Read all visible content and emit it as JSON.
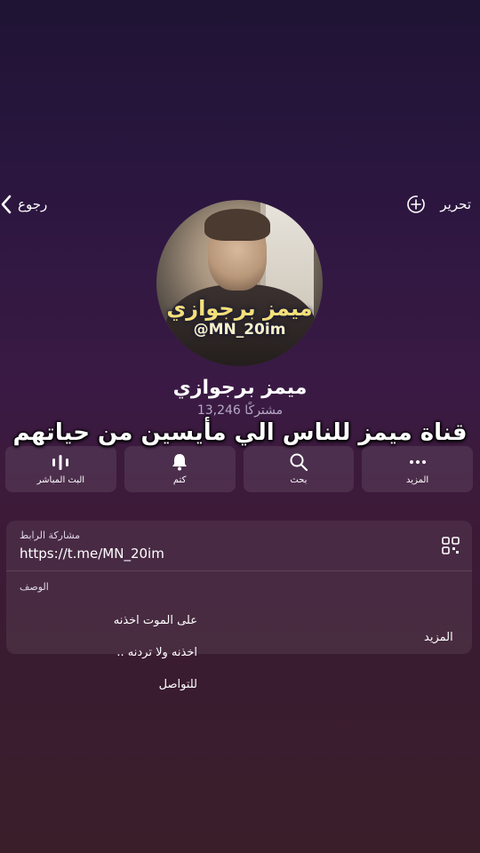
{
  "topbar": {
    "back_label": "رجوع",
    "edit_label": "تحرير"
  },
  "avatar": {
    "text_line1": "ميمز برجوازي",
    "text_line2": "@MN_20im"
  },
  "channel": {
    "name": "ميمز برجوازي",
    "subscribers": "13,246 مشتركًا"
  },
  "overlay_caption": "قناة ميمز للناس الي مأيسين من حياتهم",
  "actions": [
    {
      "label": "البث المباشر",
      "icon": "live-stream-icon"
    },
    {
      "label": "كتم",
      "icon": "bell-icon"
    },
    {
      "label": "بحث",
      "icon": "search-icon"
    },
    {
      "label": "المزيد",
      "icon": "more-dots-icon"
    }
  ],
  "info": {
    "share_caption": "مشاركة الرابط",
    "link": "https://t.me/MN_20im",
    "description_caption": "الوصف",
    "description_lines": [
      "على الموت اخذنه",
      "اخذنه ولا تردنه ..",
      "للتواصل"
    ],
    "more_label": "المزيد"
  },
  "colors": {
    "background_top": "#1f1434",
    "background_bottom": "#3a1f2a",
    "avatar_text": "#f3e07a"
  }
}
